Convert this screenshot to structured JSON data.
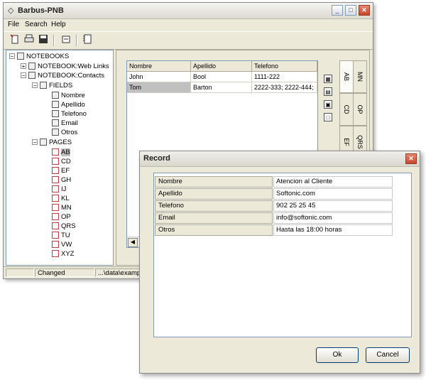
{
  "main_window": {
    "title": "Barbus-PNB",
    "title_icon": "◇",
    "buttons": {
      "minimize": "_",
      "maximize": "□",
      "close": "✕"
    }
  },
  "menu": [
    "File",
    "Search",
    "Help"
  ],
  "toolbar_icons": [
    "new-icon",
    "print-icon",
    "save-icon",
    "import-icon",
    "notebook-icon"
  ],
  "tree": {
    "root": "NOTEBOOKS",
    "notebooks": [
      "NOTEBOOK:Web Links",
      "NOTEBOOK:Contacts"
    ],
    "fields_label": "FIELDS",
    "fields": [
      "Nombre",
      "Apellido",
      "Telefono",
      "Email",
      "Otros"
    ],
    "pages_label": "PAGES",
    "pages": [
      "AB",
      "CD",
      "EF",
      "GH",
      "IJ",
      "KL",
      "MN",
      "OP",
      "QRS",
      "TU",
      "VW",
      "XYZ"
    ],
    "selected_page": "AB"
  },
  "grid": {
    "columns": [
      "Nombre",
      "Apellido",
      "Telefono"
    ],
    "rows": [
      [
        "John",
        "Bool",
        "1111-222"
      ],
      [
        "Tom",
        "Barton",
        "2222-333; 2222-444;"
      ]
    ]
  },
  "side_tabs": [
    "AB",
    "MN",
    "CD",
    "OP",
    "EF",
    "QRS"
  ],
  "status": {
    "state": "Changed",
    "path": "...\\data\\example"
  },
  "record_dialog": {
    "title": "Record",
    "close": "✕",
    "fields": [
      {
        "label": "Nombre",
        "value": "Atencion al Cliente"
      },
      {
        "label": "Apellido",
        "value": "Softonic.com"
      },
      {
        "label": "Telefono",
        "value": "902 25 25 45"
      },
      {
        "label": "Email",
        "value": "info@softonic.com"
      },
      {
        "label": "Otros",
        "value": "Hasta las 18:00 horas"
      }
    ],
    "ok_label": "Ok",
    "cancel_label": "Cancel"
  }
}
